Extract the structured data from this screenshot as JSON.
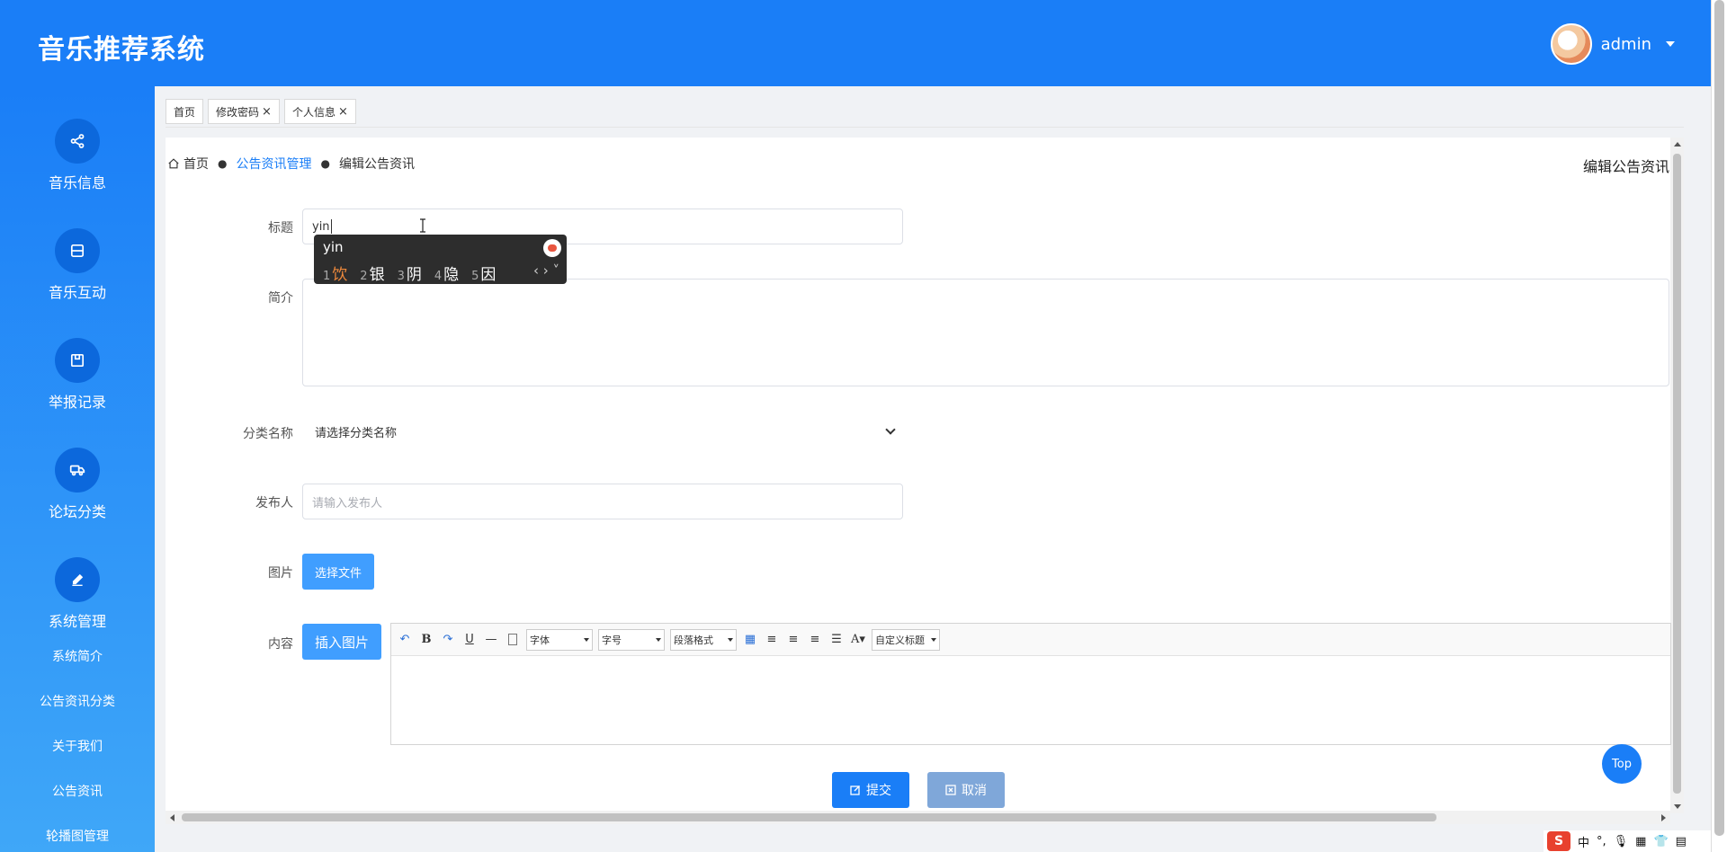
{
  "header": {
    "app_title": "音乐推荐系统",
    "user_name": "admin"
  },
  "sidebar": {
    "items": [
      {
        "label": "音乐信息",
        "icon": "share-icon"
      },
      {
        "label": "音乐互动",
        "icon": "list-icon"
      },
      {
        "label": "举报记录",
        "icon": "box-icon"
      },
      {
        "label": "论坛分类",
        "icon": "truck-icon"
      },
      {
        "label": "系统管理",
        "icon": "edit-icon"
      }
    ],
    "sub_items": [
      "系统简介",
      "公告资讯分类",
      "关于我们",
      "公告资讯",
      "轮播图管理"
    ]
  },
  "tabs": [
    {
      "label": "首页",
      "closable": false
    },
    {
      "label": "修改密码",
      "closable": true
    },
    {
      "label": "个人信息",
      "closable": true
    }
  ],
  "breadcrumb": {
    "home": "首页",
    "section": "公告资讯管理",
    "current": "编辑公告资讯"
  },
  "page_title": "编辑公告资讯",
  "form": {
    "title_label": "标题",
    "title_value": "yin",
    "intro_label": "简介",
    "category_label": "分类名称",
    "category_value": "请选择分类名称",
    "publisher_label": "发布人",
    "publisher_placeholder": "请输入发布人",
    "image_label": "图片",
    "choose_file": "选择文件",
    "content_label": "内容",
    "insert_image": "插入图片"
  },
  "editor_toolbar": {
    "font": "字体",
    "size": "字号",
    "format": "段落格式",
    "custom": "自定义标题"
  },
  "actions": {
    "submit": "提交",
    "cancel": "取消"
  },
  "ime": {
    "input": "yin",
    "candidates": [
      {
        "n": "1",
        "c": "饮"
      },
      {
        "n": "2",
        "c": "银"
      },
      {
        "n": "3",
        "c": "阴"
      },
      {
        "n": "4",
        "c": "隐"
      },
      {
        "n": "5",
        "c": "因"
      }
    ]
  },
  "top_button": "Top",
  "tray": {
    "lang": "中"
  },
  "colors": {
    "primary": "#1a7ef7",
    "button": "#409eff",
    "cancel": "#7fa7d9"
  }
}
